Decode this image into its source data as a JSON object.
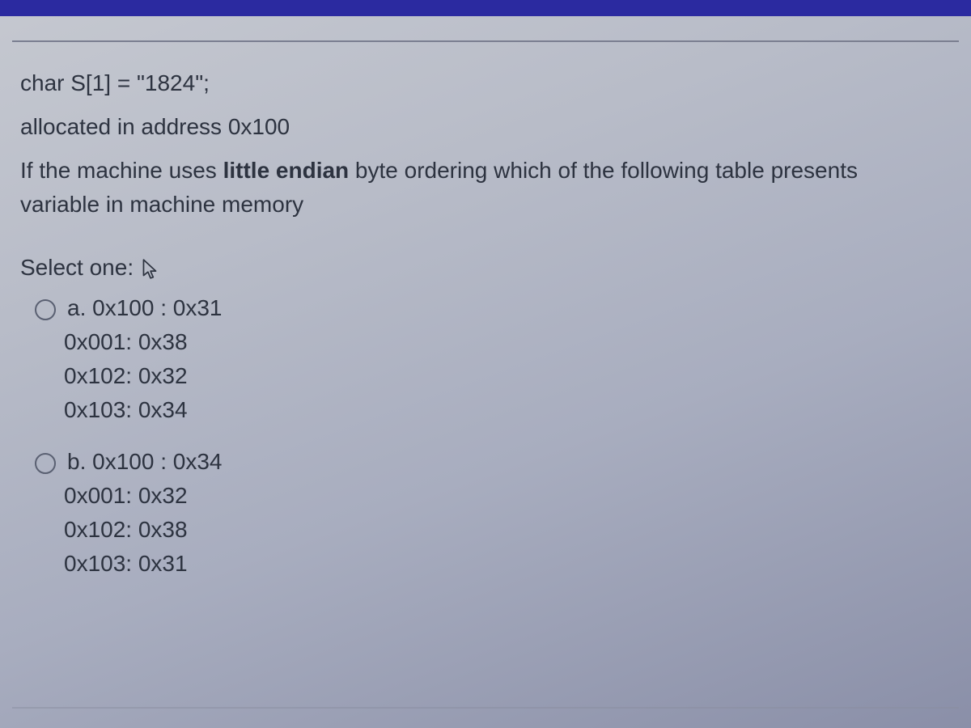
{
  "question": {
    "code_line": "char S[1] = \"1824\";",
    "alloc_line": "allocated in address 0x100",
    "intro_part1": "If the machine uses ",
    "intro_bold": "little endian",
    "intro_part2": " byte ordering which of the following table presents",
    "intro_part3": "variable in machine memory"
  },
  "select_label": "Select one:",
  "options": {
    "a": {
      "letter": "a.",
      "l1": "0x100 : 0x31",
      "l2": "0x001: 0x38",
      "l3": "0x102: 0x32",
      "l4": "0x103: 0x34"
    },
    "b": {
      "letter": "b.",
      "l1": "0x100 : 0x34",
      "l2": "0x001: 0x32",
      "l3": "0x102: 0x38",
      "l4": "0x103: 0x31"
    }
  }
}
